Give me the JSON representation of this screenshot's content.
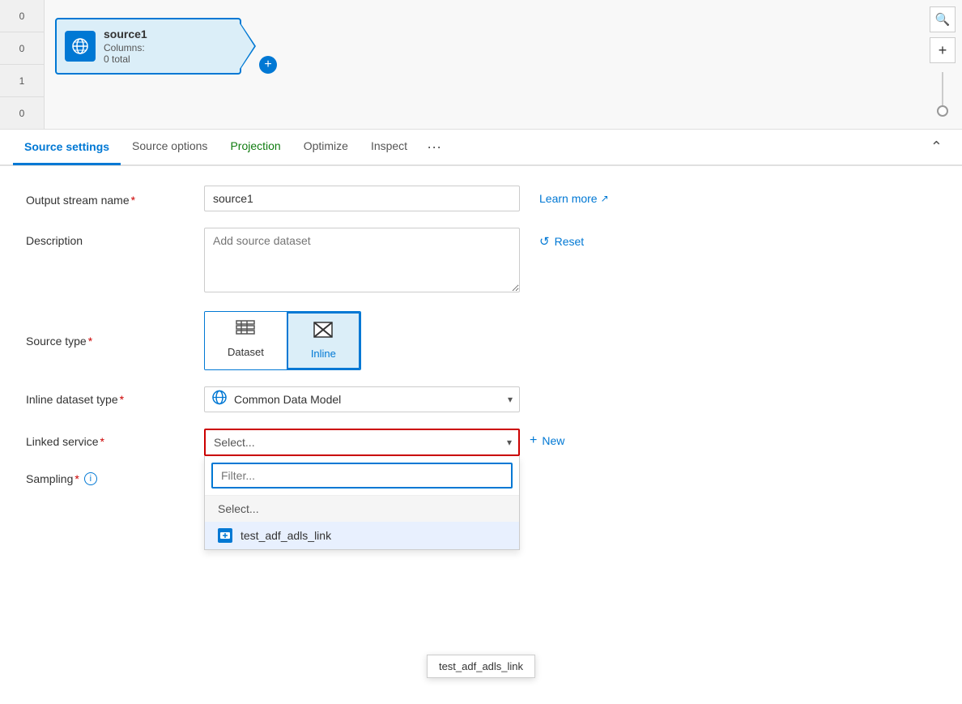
{
  "canvas": {
    "axis_labels": [
      "0",
      "0",
      "1",
      "0"
    ],
    "node": {
      "title": "source1",
      "subtitle_label": "Columns:",
      "subtitle_value": "0 total"
    },
    "plus_label": "+"
  },
  "toolbar": {
    "search_icon": "🔍",
    "plus_icon": "+",
    "collapse_icon": "⌃"
  },
  "tabs": [
    {
      "id": "source-settings",
      "label": "Source settings",
      "active": true
    },
    {
      "id": "source-options",
      "label": "Source options",
      "active": false
    },
    {
      "id": "projection",
      "label": "Projection",
      "active": false
    },
    {
      "id": "optimize",
      "label": "Optimize",
      "active": false
    },
    {
      "id": "inspect",
      "label": "Inspect",
      "active": false
    }
  ],
  "form": {
    "output_stream_name": {
      "label": "Output stream name",
      "required": true,
      "value": "source1"
    },
    "description": {
      "label": "Description",
      "required": false,
      "placeholder": "Add source dataset",
      "value": ""
    },
    "source_type": {
      "label": "Source type",
      "required": true,
      "options": [
        {
          "id": "dataset",
          "label": "Dataset",
          "active": false
        },
        {
          "id": "inline",
          "label": "Inline",
          "active": true
        }
      ]
    },
    "inline_dataset_type": {
      "label": "Inline dataset type",
      "required": true,
      "selected_label": "Common Data Model",
      "icon": "🌐"
    },
    "linked_service": {
      "label": "Linked service",
      "required": true,
      "placeholder": "Select...",
      "dropdown_open": true,
      "filter_placeholder": "Filter...",
      "options": [
        {
          "id": "select-default",
          "label": "Select...",
          "is_header": true
        },
        {
          "id": "test_adf_adls_link",
          "label": "test_adf_adls_link",
          "has_icon": true
        }
      ]
    },
    "sampling": {
      "label": "Sampling",
      "required": true,
      "has_info": true
    },
    "new_button_label": "New",
    "learn_more_label": "Learn more",
    "reset_label": "Reset",
    "tooltip_text": "test_adf_adls_link"
  }
}
